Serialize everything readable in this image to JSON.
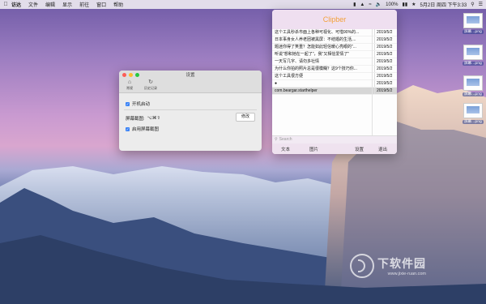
{
  "menubar": {
    "app_name": "访达",
    "items": [
      "文件",
      "编辑",
      "显示",
      "前往",
      "窗口",
      "帮助"
    ],
    "battery": "100%",
    "datetime": "5月2日 周四 下午3:33"
  },
  "desktop_icons": [
    {
      "label": "屏幕...png"
    },
    {
      "label": "屏幕...png"
    },
    {
      "label": "屏幕...png"
    },
    {
      "label": "屏幕...png"
    }
  ],
  "settings_window": {
    "title": "设置",
    "toolbar": [
      {
        "label": "常规",
        "icon": "home-icon"
      },
      {
        "label": "历史记录",
        "icon": "history-icon"
      }
    ],
    "launch_at_login": {
      "label": "开机启动",
      "checked": true
    },
    "screenshot_shortcut": {
      "label": "屏幕截图:",
      "value": "⌥⌘⇧"
    },
    "edit_button": "修改",
    "enable_screenshot": {
      "label": "启用屏幕截图",
      "checked": true
    }
  },
  "clipber_window": {
    "title": "Clipber",
    "rows": [
      {
        "text": "这个工具秒杀市面上各种可视化、可惜90%的...",
        "date": "2019/5/2"
      },
      {
        "text": "日本事身女人养老团被黑屏：不结婚的生活,...",
        "date": "2019/5/2"
      },
      {
        "text": "题迷你得了笑重？怎能如此轻信暖心亮眼的\"...",
        "date": "2019/5/2"
      },
      {
        "text": "听说\"想和她在一起了\"，我\"又相信爱情了\"",
        "date": "2019/5/2"
      },
      {
        "text": "一天写几字、请勿多社情",
        "date": "2019/5/2"
      },
      {
        "text": "为什么你拍的照片总是很模糊？这9个技巧你...",
        "date": "2019/5/2"
      },
      {
        "text": "这个工具很方便",
        "date": "2019/5/2"
      },
      {
        "text": "●",
        "date": "2019/5/2"
      },
      {
        "text": "com.beargar.starthelper",
        "date": "2019/5/2",
        "selected": true
      }
    ],
    "search_placeholder": "Search",
    "footer": [
      "文本",
      "图片",
      "设置",
      "退出"
    ]
  },
  "watermark": {
    "text": "下软件园",
    "url": "www.jixie-ruan.com"
  }
}
